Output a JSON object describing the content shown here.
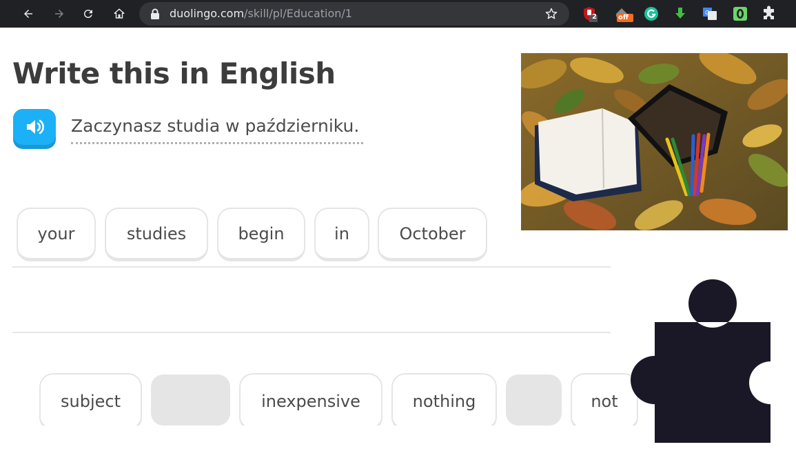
{
  "browser": {
    "url_host": "duolingo.com",
    "url_path": "/skill/pl/Education/1",
    "extensions": [
      "ublock-icon",
      "honey-icon",
      "grammarly-icon",
      "download-icon",
      "translate-icon",
      "green-extension-icon",
      "extensions-puzzle-icon"
    ],
    "ublock_badge": "2",
    "honey_badge": "off"
  },
  "exercise": {
    "title": "Write this in English",
    "prompt": "Zaczynasz studia w październiku."
  },
  "answer_tiles": [
    "your",
    "studies",
    "begin",
    "in",
    "October"
  ],
  "word_bank": {
    "tiles": [
      "subject",
      "inexpensive",
      "nothing",
      "not"
    ]
  },
  "colors": {
    "accent_blue": "#1cb0f6",
    "tile_border": "#e5e5e5",
    "text": "#4b4b4b",
    "puzzle": "#1a1826"
  }
}
